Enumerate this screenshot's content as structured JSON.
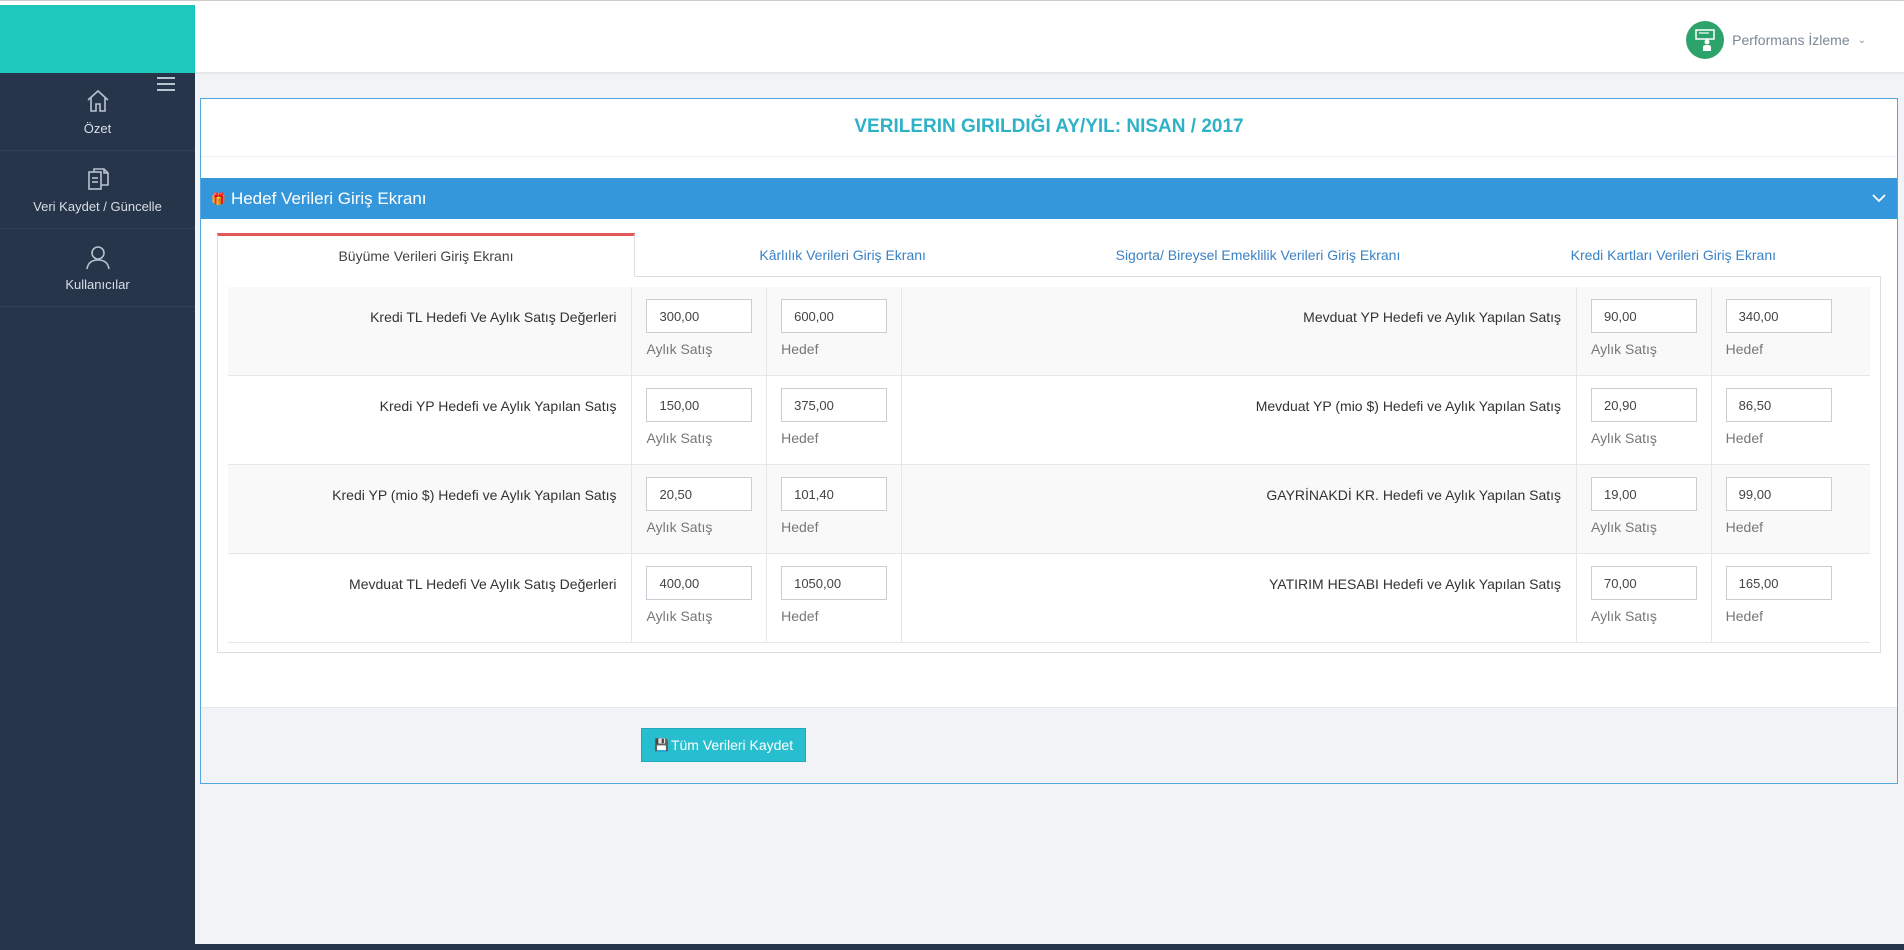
{
  "sidebar": {
    "items": [
      {
        "label": "Özet",
        "icon": "home-icon"
      },
      {
        "label": "Veri Kaydet / Güncelle",
        "icon": "documents-icon"
      },
      {
        "label": "Kullanıcılar",
        "icon": "user-icon"
      }
    ]
  },
  "header": {
    "user_name": "Performans İzleme"
  },
  "main": {
    "period_title": "VERILERIN GIRILDIĞI AY/YIL: NISAN / 2017",
    "section_title": "Hedef Verileri Giriş Ekranı",
    "tabs": [
      {
        "label": "Büyüme Verileri Giriş Ekranı"
      },
      {
        "label": "Kârlılık Verileri Giriş Ekranı"
      },
      {
        "label": "Sigorta/ Bireysel Emeklilik Verileri Giriş Ekranı"
      },
      {
        "label": "Kredi Kartları Verileri Giriş Ekranı"
      }
    ],
    "sub_labels": {
      "monthly": "Aylık Satış",
      "target": "Hedef"
    },
    "rows": [
      {
        "left_label": "Kredi TL Hedefi Ve Aylık Satış Değerleri",
        "left_monthly": "300,00",
        "left_target": "600,00",
        "right_label": "Mevduat YP Hedefi ve Aylık Yapılan Satış",
        "right_monthly": "90,00",
        "right_target": "340,00"
      },
      {
        "left_label": "Kredi YP Hedefi ve Aylık Yapılan Satış",
        "left_monthly": "150,00",
        "left_target": "375,00",
        "right_label": "Mevduat YP (mio $) Hedefi ve Aylık Yapılan Satış",
        "right_monthly": "20,90",
        "right_target": "86,50"
      },
      {
        "left_label": "Kredi YP (mio $) Hedefi ve Aylık Yapılan Satış",
        "left_monthly": "20,50",
        "left_target": "101,40",
        "right_label": "GAYRİNAKDİ KR. Hedefi ve Aylık Yapılan Satış",
        "right_monthly": "19,00",
        "right_target": "99,00"
      },
      {
        "left_label": "Mevduat TL Hedefi Ve Aylık Satış Değerleri",
        "left_monthly": "400,00",
        "left_target": "1050,00",
        "right_label": "YATIRIM HESABI Hedefi ve Aylık Yapılan Satış",
        "right_monthly": "70,00",
        "right_target": "165,00"
      }
    ],
    "save_label": "Tüm Verileri Kaydet"
  }
}
